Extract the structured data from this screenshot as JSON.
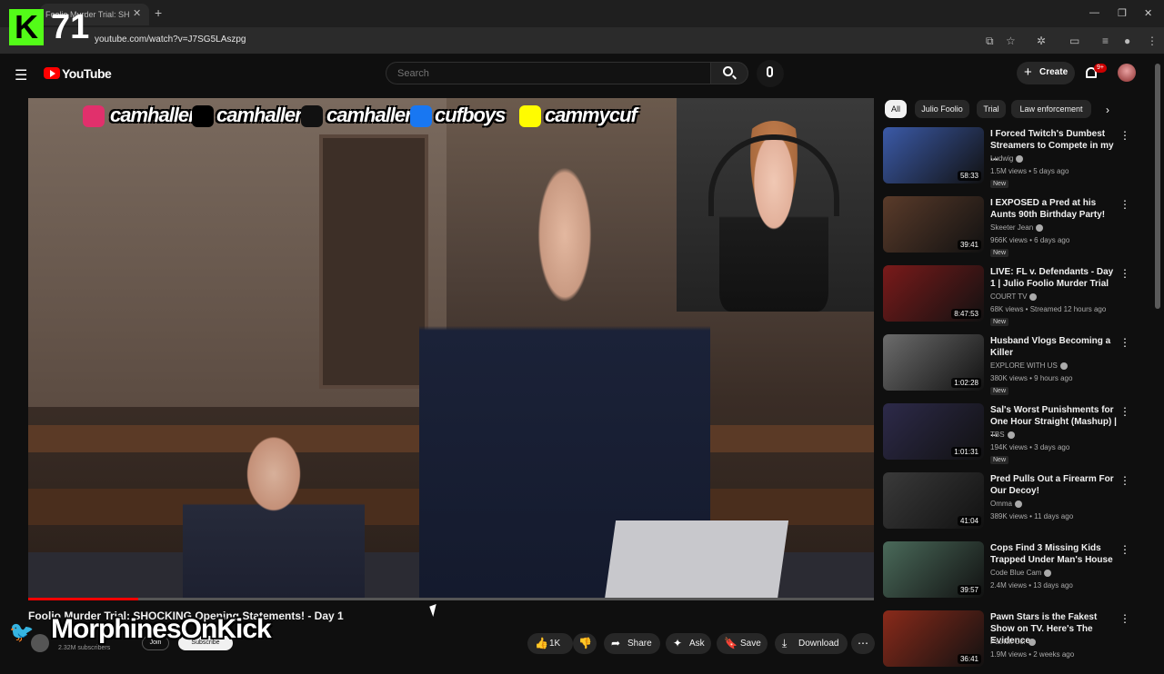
{
  "browser": {
    "tab_title": "Foolio Murder Trial: SH",
    "url": "youtube.com/watch?v=J7SG5LAszpg"
  },
  "overlay": {
    "k71_letter": "K",
    "k71_number": "71",
    "kick_name": "MorphinesOnKick",
    "socials": [
      {
        "platform": "instagram",
        "handle": "camhaller",
        "color": "#e1306c"
      },
      {
        "platform": "x",
        "handle": "camhaller",
        "color": "#000000"
      },
      {
        "platform": "tiktok",
        "handle": "camhaller",
        "color": "#111111"
      },
      {
        "platform": "facebook",
        "handle": "cufboys",
        "color": "#1877f2"
      },
      {
        "platform": "snapchat",
        "handle": "cammycuf",
        "color": "#fffc00"
      }
    ]
  },
  "header": {
    "logo_text": "YouTube",
    "search_placeholder": "Search",
    "create_label": "Create",
    "notification_badge": "9+"
  },
  "video": {
    "title": "Foolio Murder Trial: SHOCKING Opening Statements! - Day 1",
    "subscribers": "2.32M subscribers",
    "join_label": "Join",
    "subscribe_label": "Subscribe",
    "progress": 0.13
  },
  "actions": {
    "like_count": "1K",
    "share_label": "Share",
    "ask_label": "Ask",
    "save_label": "Save",
    "download_label": "Download"
  },
  "chips": [
    {
      "label": "All",
      "active": true
    },
    {
      "label": "Julio Foolio",
      "active": false
    },
    {
      "label": "Trial",
      "active": false
    },
    {
      "label": "Law enforcement",
      "active": false
    }
  ],
  "recommendations": [
    {
      "title": "I Forced Twitch's Dumbest Streamers to Compete in my ...",
      "channel": "Ludwig",
      "verified": true,
      "meta": "1.5M views • 5 days ago",
      "duration": "58:33",
      "new": "New",
      "thumb_color": "#3b5aa8"
    },
    {
      "title": "I EXPOSED a Pred at his Aunts 90th Birthday Party!",
      "channel": "Skeeter Jean",
      "verified": true,
      "meta": "966K views • 6 days ago",
      "duration": "39:41",
      "new": "New",
      "thumb_color": "#5a3b2a"
    },
    {
      "title": "LIVE: FL v. Defendants - Day 1 | Julio Foolio Murder Trial",
      "channel": "COURT TV",
      "verified": true,
      "meta": "68K views • Streamed 12 hours ago",
      "duration": "8:47:53",
      "new": "New",
      "thumb_color": "#7a1a1a"
    },
    {
      "title": "Husband Vlogs Becoming a Killer",
      "channel": "EXPLORE WITH US",
      "verified": true,
      "meta": "380K views • 9 hours ago",
      "duration": "1:02:28",
      "new": "New",
      "thumb_color": "#6c6c6c"
    },
    {
      "title": "Sal's Worst Punishments for One Hour Straight (Mashup) | ...",
      "channel": "TBS",
      "verified": true,
      "meta": "194K views • 3 days ago",
      "duration": "1:01:31",
      "new": "New",
      "thumb_color": "#2d2a4a"
    },
    {
      "title": "Pred Pulls Out a Firearm For Our Decoy!",
      "channel": "Omma",
      "verified": true,
      "meta": "389K views • 11 days ago",
      "duration": "41:04",
      "new": "",
      "thumb_color": "#3a3a3a"
    },
    {
      "title": "Cops Find 3 Missing Kids Trapped Under Man's House",
      "channel": "Code Blue Cam",
      "verified": true,
      "meta": "2.4M views • 13 days ago",
      "duration": "39:57",
      "new": "",
      "thumb_color": "#4a6a5a"
    },
    {
      "title": "Pawn Stars is the Fakest Show on TV. Here's The Evidence",
      "channel": "Patrick Cc:",
      "verified": true,
      "meta": "1.9M views • 2 weeks ago",
      "duration": "36:41",
      "new": "",
      "thumb_color": "#8a2a1a"
    }
  ]
}
